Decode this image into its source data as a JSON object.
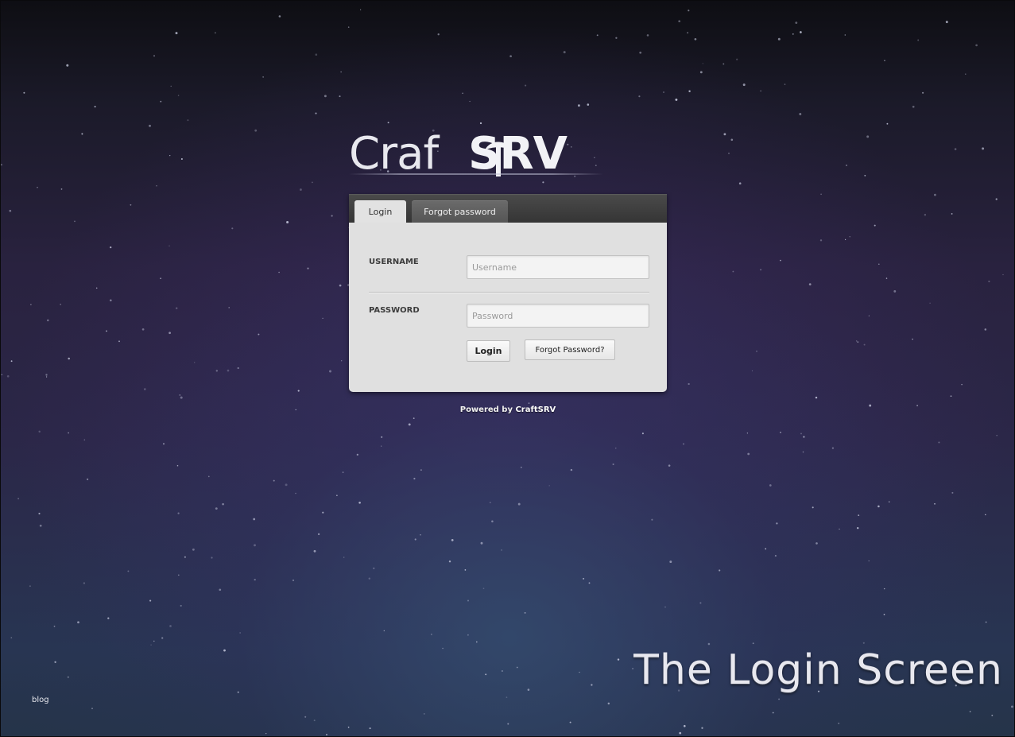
{
  "logo": {
    "text_light": "Craf",
    "text_bold": "SRV",
    "icon": "pickaxe-arrow-icon"
  },
  "tabs": [
    {
      "label": "Login",
      "active": true
    },
    {
      "label": "Forgot password",
      "active": false
    }
  ],
  "form": {
    "username_label": "USERNAME",
    "username_placeholder": "Username",
    "username_value": "",
    "password_label": "PASSWORD",
    "password_placeholder": "Password",
    "password_value": "",
    "login_button": "Login",
    "forgot_button": "Forgot Password?"
  },
  "footer": {
    "powered_prefix": "Powered by ",
    "powered_brand": "CraftSRV"
  },
  "caption": "The Login Screen",
  "blog_link": "blog",
  "colors": {
    "background_top": "#0e0e13",
    "background_mid": "#2b2748",
    "background_bottom": "#253449",
    "panel": "#e0e0e0",
    "tabbar": "#353535"
  }
}
